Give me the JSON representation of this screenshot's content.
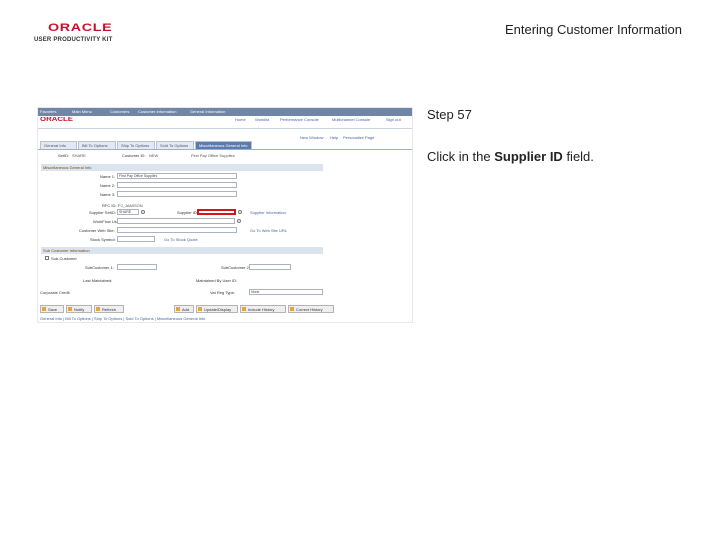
{
  "header": {
    "logo_brand": "ORACLE",
    "logo_product": "USER PRODUCTIVITY KIT",
    "title": "Entering Customer Information"
  },
  "step": {
    "label": "Step 57",
    "instruction_prefix": "Click in the ",
    "instruction_target": "Supplier ID",
    "instruction_suffix": " field."
  },
  "colors": {
    "highlight": "#d41518",
    "menubar": "#6f86a6",
    "active_tab": "#5b7bb0"
  },
  "screenshot": {
    "menu": [
      "Favorites",
      "Main Menu",
      "Customers",
      "Customer Information",
      "General Information"
    ],
    "nav_links": [
      "Home",
      "Worklist",
      "Performance Console",
      "Multichannel Console",
      "Sign out"
    ],
    "utility_links": [
      "New Window",
      "Help",
      "Personalize Page"
    ],
    "tabs": [
      "General Info",
      "Bill To Options",
      "Ship To Options",
      "Sold To Options",
      "Miscellaneous General Info"
    ],
    "setid_label": "SetID:",
    "setid_value": "SHARE",
    "customer_id_label": "Customer ID:",
    "customer_id_value": "NEW",
    "customer_name": "First Pay Office Supplies",
    "section_misc": "Miscellaneous General Info",
    "name1_label": "Name 1:",
    "name1_value": "First Pay Office Supplies",
    "name2_label": "Name 2:",
    "name3_label": "Name 3:",
    "rfc_label": "RFC ID:",
    "rfc_value": "PJ_JAMISON",
    "supplier_setid_label": "Supplier SetID:",
    "supplier_setid_value": "SHARE",
    "supplier_id_label": "Supplier ID:",
    "supplier_link": "Supplier Information",
    "workflow_label": "WorkFlow User:",
    "website_label": "Customer Web Site:",
    "website_link": "Go To Web Site URL",
    "stock_symbol_label": "Stock Symbol:",
    "stock_link": "Go To Stock Quote",
    "section_sub": "Sub Customer Information",
    "subcustomer_check": "Sub-Customer",
    "subcustomer1_label": "SubCustomer 1:",
    "subcustomer2_label": "SubCustomer 2:",
    "last_maintained_label": "Last Maintained:",
    "maintained_by_label": "Maintained By User ID:",
    "corp_credit_label": "Corporate Credit",
    "vat_label": "Vat Reg Type:",
    "vat_value": "None",
    "buttons": [
      "Save",
      "Notify",
      "Refresh",
      "Add",
      "Update/Display",
      "Include History",
      "Correct History"
    ],
    "footer_links": "General Info | Bill To Options | Ship To Options | Sold To Options | Miscellaneous General Info"
  }
}
